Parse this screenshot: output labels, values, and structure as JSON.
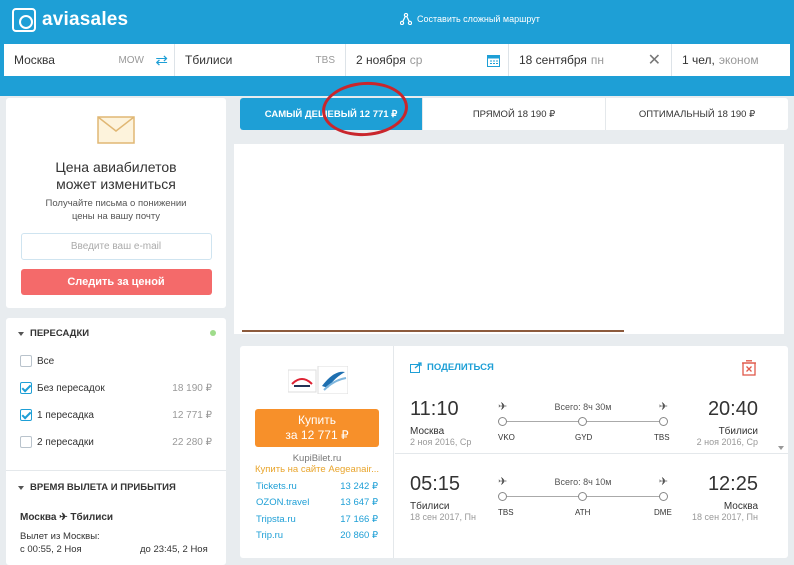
{
  "header": {
    "logo_text": "aviasales",
    "complex_route": "Составить сложный маршрут"
  },
  "search": {
    "origin": "Москва",
    "origin_code": "MOW",
    "destination": "Тбилиси",
    "destination_code": "TBS",
    "date_out": "2 ноября",
    "date_out_day": "ср",
    "date_back": "18 сентября",
    "date_back_day": "пн",
    "passengers": "1 чел,",
    "cabin": "эконом"
  },
  "subscribe": {
    "title_line1": "Цена авиабилетов",
    "title_line2": "может измениться",
    "desc_line1": "Получайте письма о понижении",
    "desc_line2": "цены на вашу почту",
    "email_placeholder": "Введите ваш e-mail",
    "button": "Следить за ценой"
  },
  "filters": {
    "stops_title": "ПЕРЕСАДКИ",
    "options": [
      {
        "label": "Все",
        "price": "",
        "checked": false
      },
      {
        "label": "Без пересадок",
        "price": "18 190 ₽",
        "checked": true
      },
      {
        "label": "1 пересадка",
        "price": "12 771 ₽",
        "checked": true
      },
      {
        "label": "2 пересадки",
        "price": "22 280 ₽",
        "checked": false
      }
    ],
    "time_title": "ВРЕМЯ ВЫЛЕТА И ПРИБЫТИЯ",
    "route_from": "Москва",
    "route_to": "Тбилиси",
    "departure_label": "Вылет из Москвы:",
    "time_from": "с 00:55, 2 Ноя",
    "time_to": "до 23:45, 2 Ноя"
  },
  "tabs": [
    {
      "label": "САМЫЙ ДЕШЕВЫЙ 12 771 ₽",
      "active": true
    },
    {
      "label": "ПРЯМОЙ 18 190 ₽",
      "active": false
    },
    {
      "label": "ОПТИМАЛЬНЫЙ 18 190 ₽",
      "active": false
    }
  ],
  "ticket": {
    "buy_line1": "Купить",
    "buy_line2": "за 12 771 ₽",
    "agent": "KupiBilet.ru",
    "agent_site": "Купить на сайте Aegeanair...",
    "offers": [
      {
        "name": "Tickets.ru",
        "price": "13 242 ₽"
      },
      {
        "name": "OZON.travel",
        "price": "13 647 ₽"
      },
      {
        "name": "Tripsta.ru",
        "price": "17 166 ₽"
      },
      {
        "name": "Trip.ru",
        "price": "20 860 ₽"
      }
    ],
    "share": "ПОДЕЛИТЬСЯ",
    "segments": [
      {
        "dep_time": "11:10",
        "dep_city": "Москва",
        "dep_date": "2 ноя 2016, Ср",
        "arr_time": "20:40",
        "arr_city": "Тбилиси",
        "arr_date": "2 ноя 2016, Ср",
        "duration": "Всего: 8ч 30м",
        "codes": [
          "VKO",
          "GYD",
          "TBS"
        ]
      },
      {
        "dep_time": "05:15",
        "dep_city": "Тбилиси",
        "dep_date": "18 сен 2017, Пн",
        "arr_time": "12:25",
        "arr_city": "Москва",
        "arr_date": "18 сен 2017, Пн",
        "duration": "Всего: 8ч 10м",
        "codes": [
          "TBS",
          "ATH",
          "DME"
        ]
      }
    ]
  }
}
